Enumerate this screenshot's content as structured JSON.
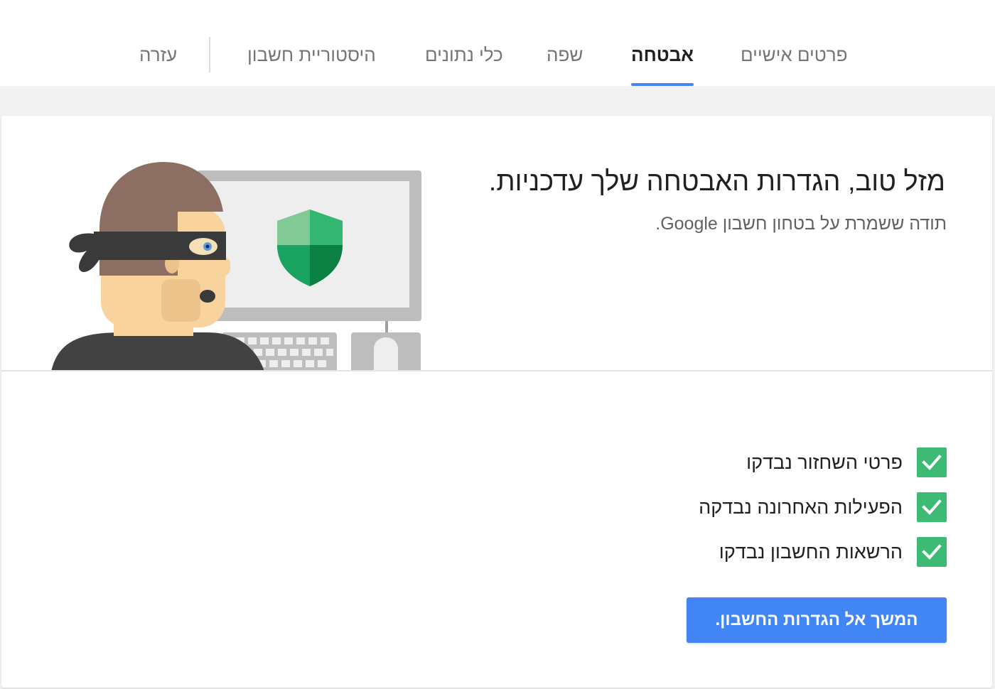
{
  "nav": {
    "tabs": [
      {
        "label": "פרטים אישיים",
        "active": false
      },
      {
        "label": "אבטחה",
        "active": true
      },
      {
        "label": "שפה",
        "active": false
      },
      {
        "label": "כלי נתונים",
        "active": false
      },
      {
        "label": "היסטוריית חשבון",
        "active": false
      }
    ],
    "help_label": "עזרה"
  },
  "hero": {
    "title": "מזל טוב, הגדרות האבטחה שלך עדכניות.",
    "subtitle": "תודה ששמרת על בטחון חשבון Google.",
    "illustration_icon": "security-shield-thief-illustration"
  },
  "checks": [
    {
      "label": "פרטי השחזור נבדקו",
      "checked": true
    },
    {
      "label": "הפעילות האחרונה נבדקה",
      "checked": true
    },
    {
      "label": "הרשאות החשבון נבדקו",
      "checked": true
    }
  ],
  "cta_label": "המשך אל הגדרות החשבון.",
  "colors": {
    "accent": "#4285f4",
    "check_green": "#3dba73",
    "shield_green": "#0f9d58"
  }
}
